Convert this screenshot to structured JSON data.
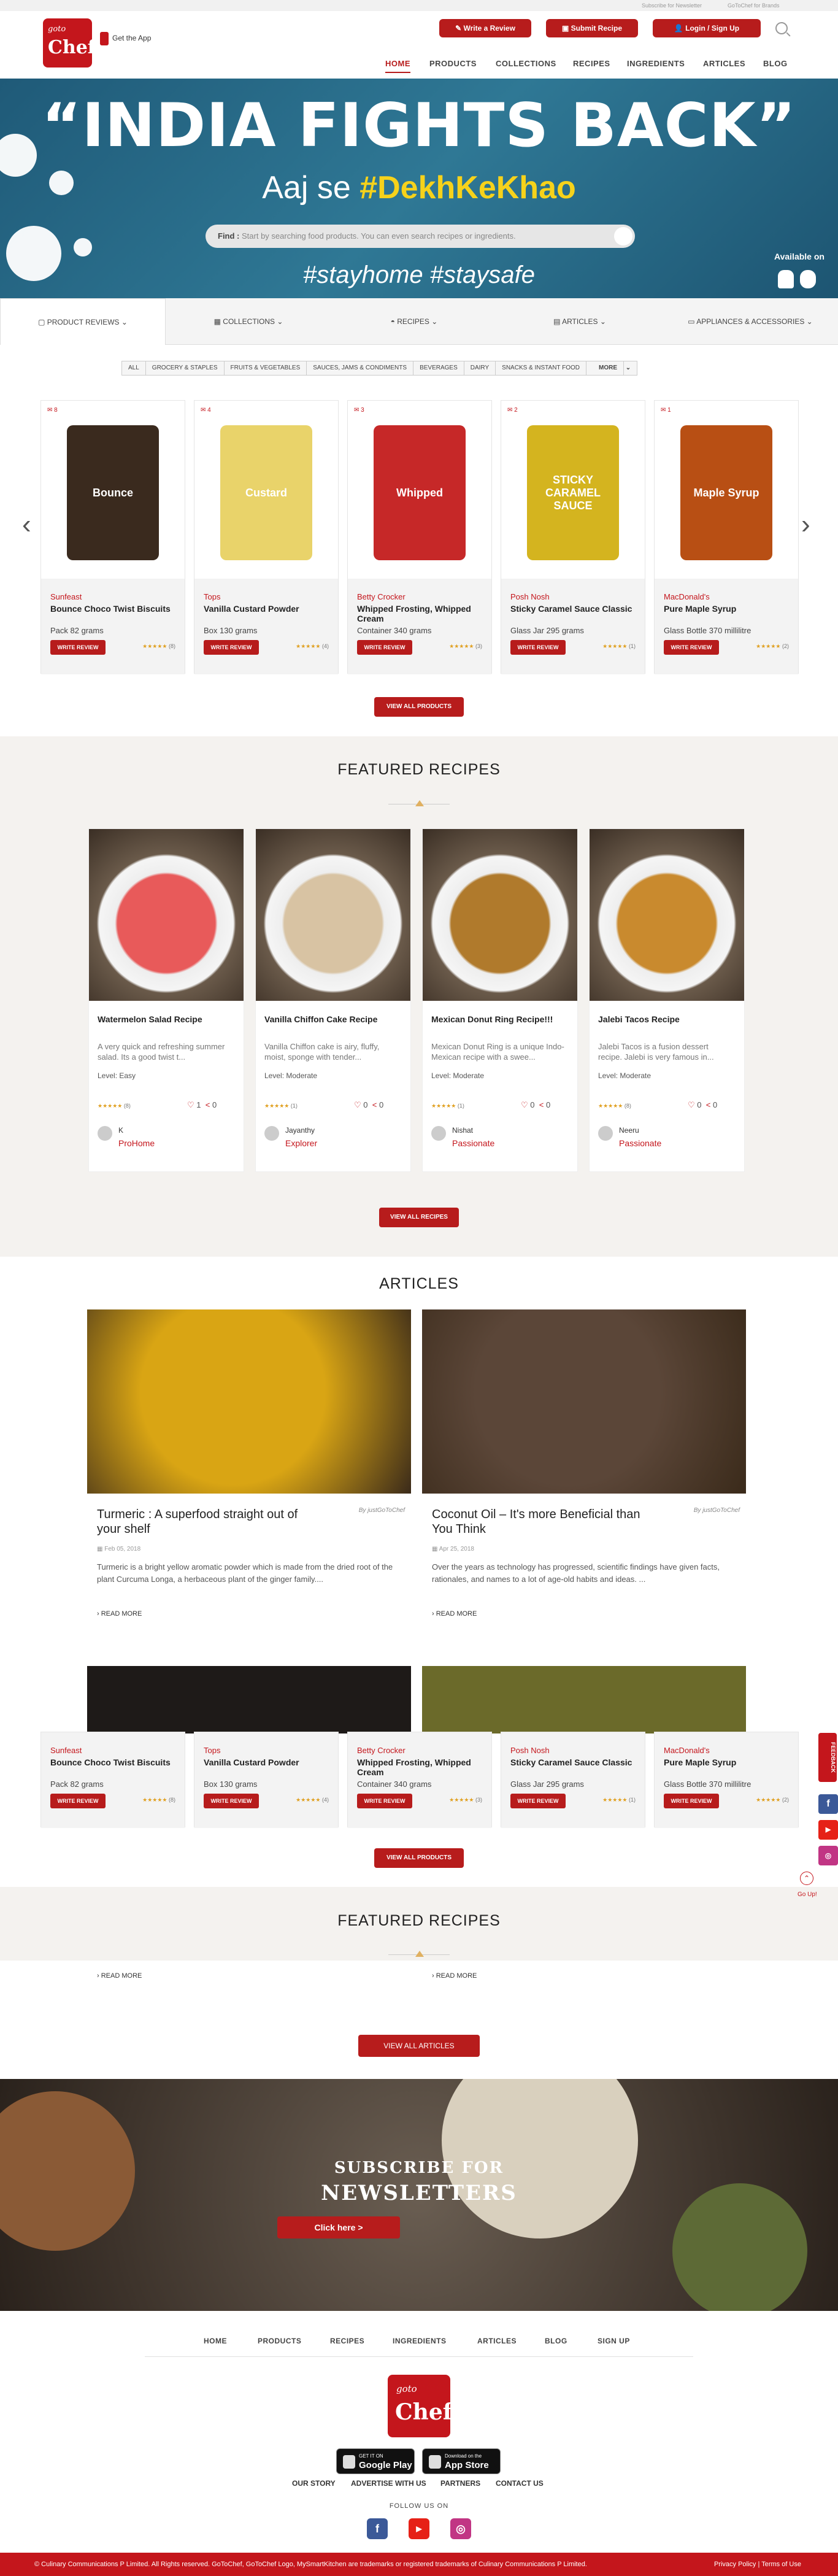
{
  "topbar": {
    "subscribe": "Subscribe for Newsletter",
    "brands": "GoToChef for Brands"
  },
  "header": {
    "logo_small": "goto",
    "logo_big": "Chef",
    "get_app": "Get the App",
    "write_review": "Write a Review",
    "submit_recipe": "Submit Recipe",
    "login": "Login / Sign Up",
    "nav": [
      "HOME",
      "PRODUCTS",
      "COLLECTIONS",
      "RECIPES",
      "INGREDIENTS",
      "ARTICLES",
      "BLOG"
    ]
  },
  "hero": {
    "headline": "“INDIA FIGHTS BACK”",
    "sub_prefix": "Aaj se ",
    "sub_hashtag": "#DekhKeKhao",
    "search_label": "Find :",
    "search_placeholder": "Start by searching food products. You can even search recipes or ingredients.",
    "tags": "#stayhome  #staysafe",
    "available_on": "Available on"
  },
  "categories": [
    "PRODUCT REVIEWS",
    "COLLECTIONS",
    "RECIPES",
    "ARTICLES",
    "APPLIANCES & ACCESSORIES"
  ],
  "chips": [
    "ALL",
    "GROCERY & STAPLES",
    "FRUITS & VEGETABLES",
    "SAUCES, JAMS & CONDIMENTS",
    "BEVERAGES",
    "DAIRY",
    "SNACKS & INSTANT FOOD",
    "MORE"
  ],
  "products": [
    {
      "count": "8",
      "brand": "Sunfeast",
      "name": "Bounce Choco Twist Biscuits",
      "pack": "Pack 82 grams",
      "reviews": "(8)",
      "stars": "★★★★★",
      "img_text": "Bounce",
      "img_color": "#3a2a1e"
    },
    {
      "count": "4",
      "brand": "Tops",
      "name": "Vanilla Custard Powder",
      "pack": "Box 130 grams",
      "reviews": "(4)",
      "stars": "★★★★★",
      "img_text": "Custard",
      "img_color": "#e9d36a"
    },
    {
      "count": "3",
      "brand": "Betty Crocker",
      "name": "Whipped Frosting, Whipped Cream",
      "pack": "Container 340 grams",
      "reviews": "(3)",
      "stars": "★★★★★",
      "img_text": "Whipped",
      "img_color": "#c62828"
    },
    {
      "count": "2",
      "brand": "Posh Nosh",
      "name": "Sticky Caramel Sauce Classic",
      "pack": "Glass Jar 295 grams",
      "reviews": "(1)",
      "stars": "★★★★★",
      "img_text": "STICKY CARAMEL SAUCE",
      "img_color": "#d4b41f"
    },
    {
      "count": "1",
      "brand": "MacDonald's",
      "name": "Pure Maple Syrup",
      "pack": "Glass Bottle 370 millilitre",
      "reviews": "(2)",
      "stars": "★★★★★",
      "img_text": "Maple Syrup",
      "img_color": "#b84f14"
    }
  ],
  "write_review_btn": "WRITE REVIEW",
  "view_all_products": "VIEW ALL PRODUCTS",
  "featured_recipes_title": "FEATURED RECIPES",
  "recipes": [
    {
      "title": "Watermelon Salad Recipe",
      "desc": "A very quick and refreshing summer salad. Its a good twist t...",
      "level": "Level: Easy",
      "reviews": "(8)",
      "likes": "1",
      "shares": "0",
      "author": "K",
      "badge": "ProHome",
      "img_color": "#e85a5a"
    },
    {
      "title": "Vanilla Chiffon Cake Recipe",
      "desc": "Vanilla Chiffon cake is airy, fluffy, moist, sponge with tender...",
      "level": "Level: Moderate",
      "reviews": "(1)",
      "likes": "0",
      "shares": "0",
      "author": "Jayanthy",
      "badge": "Explorer",
      "img_color": "#d8c3a3"
    },
    {
      "title": "Mexican Donut Ring Recipe!!!",
      "desc": "Mexican Donut Ring is a unique Indo-Mexican recipe with a swee...",
      "level": "Level: Moderate",
      "reviews": "(1)",
      "likes": "0",
      "shares": "0",
      "author": "Nishat",
      "badge": "Passionate",
      "img_color": "#b07a2c"
    },
    {
      "title": "Jalebi Tacos Recipe",
      "desc": "Jalebi Tacos is a fusion dessert recipe. Jalebi is very famous in...",
      "level": "Level: Moderate",
      "reviews": "(8)",
      "likes": "0",
      "shares": "0",
      "author": "Neeru",
      "badge": "Passionate",
      "img_color": "#c98a2e"
    }
  ],
  "view_all_recipes": "VIEW ALL RECIPES",
  "articles_title": "ARTICLES",
  "articles": [
    {
      "title": "Turmeric : A superfood straight out of your shelf",
      "by": "By justGoToChef",
      "date": "Feb 05, 2018",
      "desc": "Turmeric is a bright yellow aromatic powder which is made from the dried root of the plant Curcuma Longa, a herbaceous plant of the ginger family....",
      "read_more": "READ MORE",
      "img_color": "#d9a514"
    },
    {
      "title": "Coconut Oil – It's more Beneficial than You Think",
      "by": "By justGoToChef",
      "date": "Apr 25, 2018",
      "desc": "Over the years as technology has progressed, scientific findings have given facts, rationales, and names to a lot of age-old habits and ideas. ...",
      "read_more": "READ MORE",
      "img_color": "#5b4638"
    }
  ],
  "view_all_articles": "VIEW ALL ARTICLES",
  "read_more": "READ MORE",
  "subscribe": {
    "line1": "SUBSCRIBE FOR",
    "line2": "NEWSLETTERS",
    "button": "Click here >"
  },
  "feedback": "FEEDBACK",
  "go_up": "Go Up!",
  "footer": {
    "nav": [
      "HOME",
      "PRODUCTS",
      "RECIPES",
      "INGREDIENTS",
      "ARTICLES",
      "BLOG",
      "SIGN UP"
    ],
    "google_small": "GET IT ON",
    "google_big": "Google Play",
    "apple_small": "Download on the",
    "apple_big": "App Store",
    "links": [
      "OUR STORY",
      "ADVERTISE WITH US",
      "PARTNERS",
      "CONTACT US"
    ],
    "follow": "FOLLOW US ON",
    "copyright": "© Culinary Communications P Limited. All Rights reserved. GoToChef, GoToChef Logo, MySmartKitchen are trademarks or registered trademarks of Culinary Communications P Limited.",
    "policy": "Privacy Policy  |  Terms of Use"
  },
  "colors": {
    "brand": "#c4161c",
    "button": "#b71c1c",
    "hero_bg": "#2a6e8c",
    "hashtag": "#f6d21b"
  }
}
